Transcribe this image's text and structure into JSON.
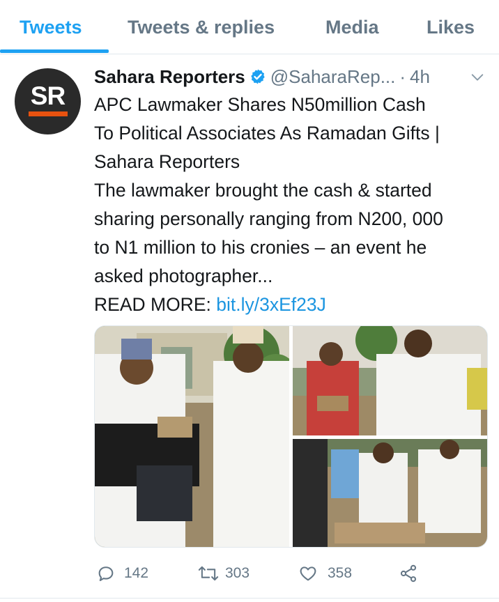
{
  "tabs": [
    {
      "label": "Tweets",
      "active": true
    },
    {
      "label": "Tweets & replies",
      "active": false
    },
    {
      "label": "Media",
      "active": false
    },
    {
      "label": "Likes",
      "active": false
    }
  ],
  "tweet": {
    "avatar_text": "SR",
    "author": "Sahara Reporters",
    "verified": true,
    "handle": "@SaharaRep...",
    "separator": "·",
    "time": "4h",
    "body_lines": [
      "APC Lawmaker Shares N50million Cash",
      "To Political Associates As Ramadan Gifts |",
      "Sahara Reporters",
      "The lawmaker brought the cash & started",
      "sharing personally ranging from N200, 000",
      "to N1 million to his cronies – an event he",
      "asked photographer..."
    ],
    "read_more_label": "READ MORE:",
    "link_text": "bit.ly/3xEf23J",
    "replies": "142",
    "retweets": "303",
    "likes": "358"
  },
  "colors": {
    "accent": "#1da1f2",
    "link": "#1b95e0",
    "muted": "#657786",
    "avatar_bg": "#2a2a2a",
    "avatar_bar": "#e8520f"
  },
  "icons": [
    "verified-badge-icon",
    "chevron-down-icon",
    "reply-icon",
    "retweet-icon",
    "like-icon",
    "share-icon"
  ]
}
